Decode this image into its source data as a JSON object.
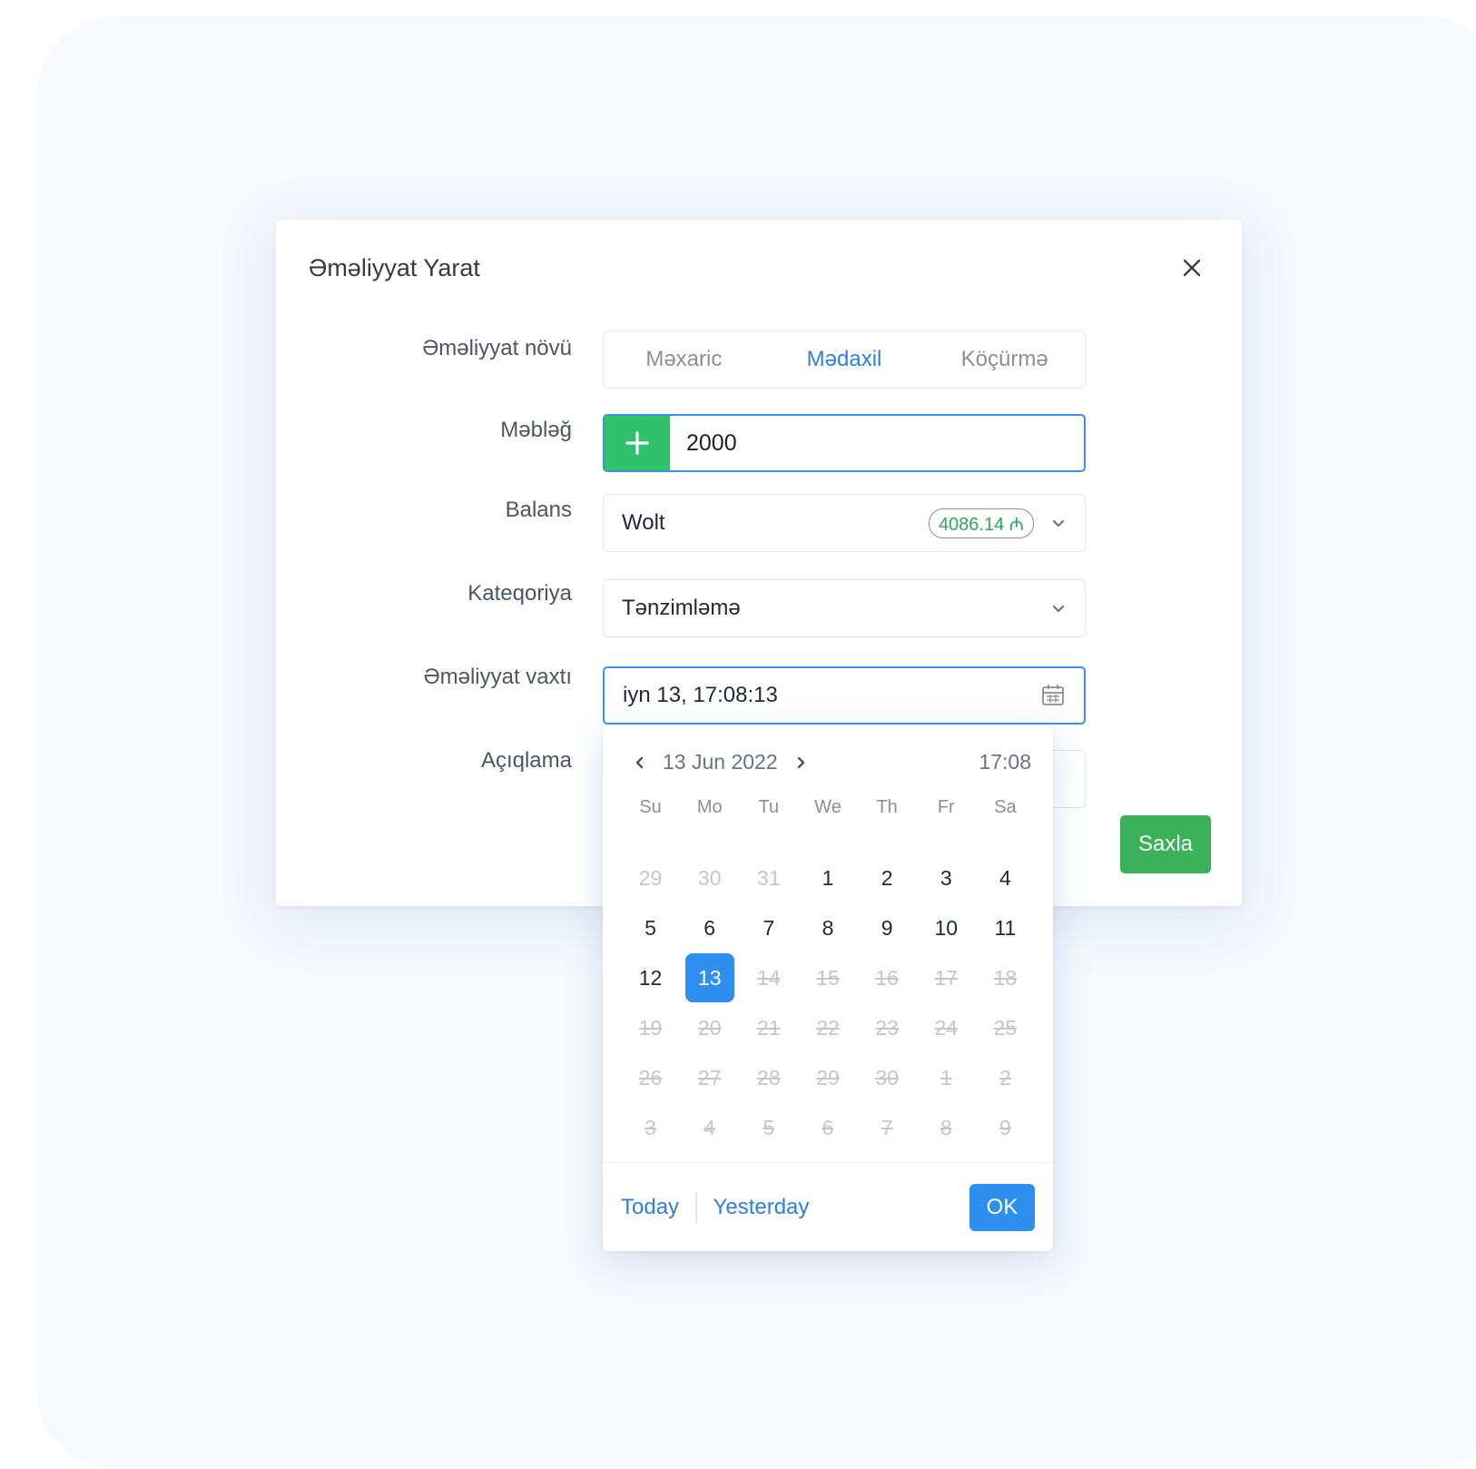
{
  "modal": {
    "title": "Əməliyyat Yarat",
    "close_icon": "close-icon"
  },
  "form": {
    "type_label": "Əməliyyat növü",
    "type_options": [
      "Məxaric",
      "Mədaxil",
      "Köçürmə"
    ],
    "type_selected": "Mədaxil",
    "amount_label": "Məbləğ",
    "amount_value": "2000",
    "amount_sign_icon": "plus-icon",
    "balance_label": "Balans",
    "balance_value": "Wolt",
    "balance_amount": "4086.14 ₼",
    "category_label": "Kateqoriya",
    "category_value": "Tənzimləmə",
    "datetime_label": "Əməliyyat vaxtı",
    "datetime_value": "iyn 13, 17:08:13",
    "description_label": "Açıqlama",
    "save_label": "Saxla"
  },
  "datepicker": {
    "month_label": "13 Jun 2022",
    "time_label": "17:08",
    "weekdays": [
      "Su",
      "Mo",
      "Tu",
      "We",
      "Th",
      "Fr",
      "Sa"
    ],
    "selected_day": "13",
    "weeks": [
      [
        {
          "d": "29",
          "s": "muted"
        },
        {
          "d": "30",
          "s": "muted"
        },
        {
          "d": "31",
          "s": "muted"
        },
        {
          "d": "1",
          "s": "normal"
        },
        {
          "d": "2",
          "s": "normal"
        },
        {
          "d": "3",
          "s": "normal"
        },
        {
          "d": "4",
          "s": "normal"
        }
      ],
      [
        {
          "d": "5",
          "s": "normal"
        },
        {
          "d": "6",
          "s": "normal"
        },
        {
          "d": "7",
          "s": "normal"
        },
        {
          "d": "8",
          "s": "normal"
        },
        {
          "d": "9",
          "s": "normal"
        },
        {
          "d": "10",
          "s": "normal"
        },
        {
          "d": "11",
          "s": "normal"
        }
      ],
      [
        {
          "d": "12",
          "s": "normal"
        },
        {
          "d": "13",
          "s": "selected"
        },
        {
          "d": "14",
          "s": "disabled"
        },
        {
          "d": "15",
          "s": "disabled"
        },
        {
          "d": "16",
          "s": "disabled"
        },
        {
          "d": "17",
          "s": "disabled"
        },
        {
          "d": "18",
          "s": "disabled"
        }
      ],
      [
        {
          "d": "19",
          "s": "disabled"
        },
        {
          "d": "20",
          "s": "disabled"
        },
        {
          "d": "21",
          "s": "disabled"
        },
        {
          "d": "22",
          "s": "disabled"
        },
        {
          "d": "23",
          "s": "disabled"
        },
        {
          "d": "24",
          "s": "disabled"
        },
        {
          "d": "25",
          "s": "disabled"
        }
      ],
      [
        {
          "d": "26",
          "s": "disabled"
        },
        {
          "d": "27",
          "s": "disabled"
        },
        {
          "d": "28",
          "s": "disabled"
        },
        {
          "d": "29",
          "s": "disabled"
        },
        {
          "d": "30",
          "s": "disabled"
        },
        {
          "d": "1",
          "s": "disabled"
        },
        {
          "d": "2",
          "s": "disabled"
        }
      ],
      [
        {
          "d": "3",
          "s": "disabled"
        },
        {
          "d": "4",
          "s": "disabled"
        },
        {
          "d": "5",
          "s": "disabled"
        },
        {
          "d": "6",
          "s": "disabled"
        },
        {
          "d": "7",
          "s": "disabled"
        },
        {
          "d": "8",
          "s": "disabled"
        },
        {
          "d": "9",
          "s": "disabled"
        }
      ]
    ],
    "today_label": "Today",
    "yesterday_label": "Yesterday",
    "ok_label": "OK"
  },
  "colors": {
    "accent_blue": "#2f8ff0",
    "plus_green": "#2fc26a",
    "save_green": "#3bb25a",
    "balance_green": "#2ea85a"
  }
}
